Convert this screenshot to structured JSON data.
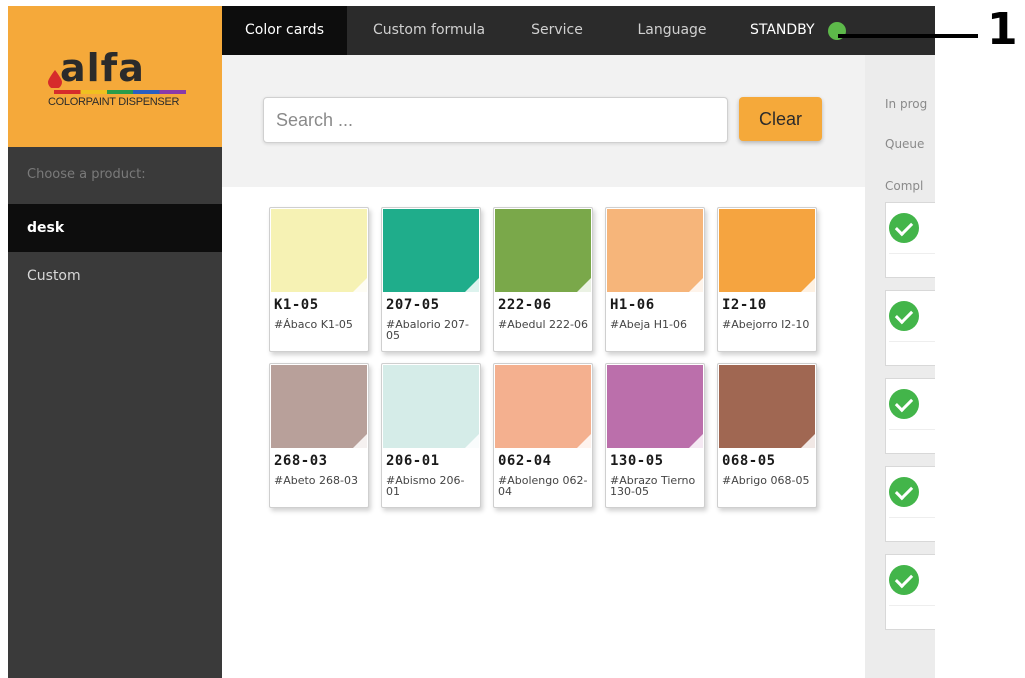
{
  "brand": {
    "logo_text": "alfa",
    "subtitle": "COLORPAINT DISPENSER"
  },
  "sidebar": {
    "choose_label": "Choose a product:",
    "products": [
      {
        "label": "desk",
        "active": true
      },
      {
        "label": "Custom",
        "active": false
      }
    ]
  },
  "nav": {
    "tabs": [
      {
        "label": "Color cards",
        "active": true
      },
      {
        "label": "Custom formula",
        "active": false
      },
      {
        "label": "Service",
        "active": false
      },
      {
        "label": "Language",
        "active": false
      }
    ],
    "status_label": "STANDBY",
    "status_color": "#5db94a"
  },
  "search": {
    "placeholder": "Search ...",
    "value": "",
    "clear_label": "Clear"
  },
  "queue": {
    "in_progress_label": "In prog",
    "queued_label": "Queue",
    "completed_label": "Compl",
    "completed_count": 5
  },
  "color_cards": [
    {
      "code": "K1-05",
      "name": "#Ábaco K1-05",
      "color": "#f6f2b4"
    },
    {
      "code": "207-05",
      "name": "#Abalorio 207-05",
      "color": "#1fad8b"
    },
    {
      "code": "222-06",
      "name": "#Abedul 222-06",
      "color": "#7aa84a"
    },
    {
      "code": "H1-06",
      "name": "#Abeja H1-06",
      "color": "#f6b57a"
    },
    {
      "code": "I2-10",
      "name": "#Abejorro I2-10",
      "color": "#f5a440"
    },
    {
      "code": "268-03",
      "name": "#Abeto 268-03",
      "color": "#b8a09a"
    },
    {
      "code": "206-01",
      "name": "#Abismo 206-01",
      "color": "#d5ece8"
    },
    {
      "code": "062-04",
      "name": "#Abolengo 062-04",
      "color": "#f4b08f"
    },
    {
      "code": "130-05",
      "name": "#Abrazo Tierno 130-05",
      "color": "#bb6fab"
    },
    {
      "code": "068-05",
      "name": "#Abrigo 068-05",
      "color": "#a06752"
    }
  ],
  "callout": {
    "number": "1"
  },
  "colors": {
    "accent": "#f5a93a",
    "sidebar": "#3a3a3a",
    "nav": "#2b2b2b",
    "active_tab": "#0d0d0d",
    "check": "#43b54a"
  }
}
